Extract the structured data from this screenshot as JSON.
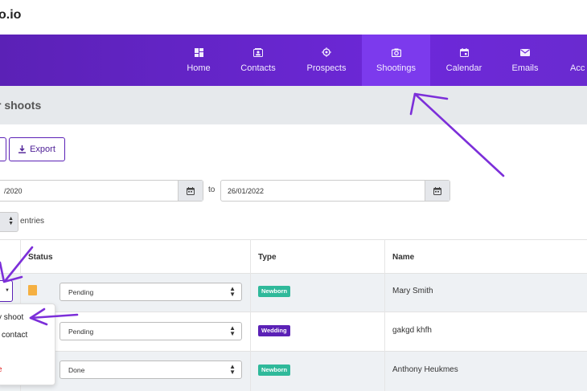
{
  "brand": "o.io",
  "nav": [
    {
      "label": "Home",
      "icon": "dashboard-icon"
    },
    {
      "label": "Contacts",
      "icon": "contact-card-icon"
    },
    {
      "label": "Prospects",
      "icon": "target-icon"
    },
    {
      "label": "Shootings",
      "icon": "camera-icon"
    },
    {
      "label": "Calendar",
      "icon": "calendar-icon"
    },
    {
      "label": "Emails",
      "icon": "mail-icon"
    },
    {
      "label": "Acc",
      "icon": "account-icon"
    }
  ],
  "page_title": "r shoots",
  "export_label": "Export",
  "date_from": "/2020",
  "date_to_label": "to",
  "date_to": "26/01/2022",
  "entries_label": "entries",
  "table": {
    "headers": {
      "status": "Status",
      "type": "Type",
      "name": "Name"
    },
    "rows": [
      {
        "status": "Pending",
        "type": "Newborn",
        "name": "Mary Smith"
      },
      {
        "status": "Pending",
        "type": "Wedding",
        "name": "gakgd khfh"
      },
      {
        "status": "Done",
        "type": "Newborn",
        "name": "Anthony Heukmes"
      }
    ]
  },
  "menu": {
    "item1": "y shoot",
    "item2": "contact",
    "item3": "e"
  },
  "colors": {
    "accent": "#5b21b6",
    "newborn": "#2fb99a",
    "wedding": "#5b21b6",
    "delete": "#e02424",
    "annotation": "#7c2fd9"
  }
}
